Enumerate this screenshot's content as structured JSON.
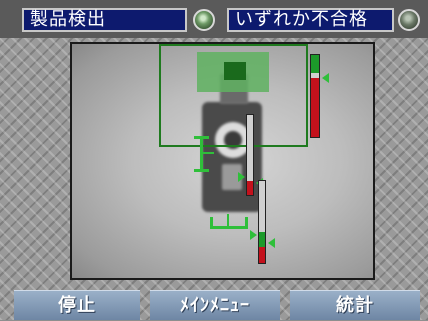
{
  "header": {
    "title": "製品検出",
    "status": "いずれか不合格"
  },
  "buttons": {
    "stop": "停止",
    "main_menu": "ﾒｲﾝﾒﾆｭｰ",
    "stats": "統計"
  },
  "meters": [
    {
      "green_fraction": 0.22,
      "red_fraction": 0.72
    },
    {
      "green_fraction": 0.0,
      "red_fraction": 0.18
    },
    {
      "green_fraction": 0.18,
      "red_fraction": 0.2
    }
  ],
  "colors": {
    "title_bg": "#0d1a6e",
    "roi": "#1f7a1f",
    "ok": "#1c9a2a",
    "ng": "#c4111c",
    "button": "#7f95b1"
  }
}
